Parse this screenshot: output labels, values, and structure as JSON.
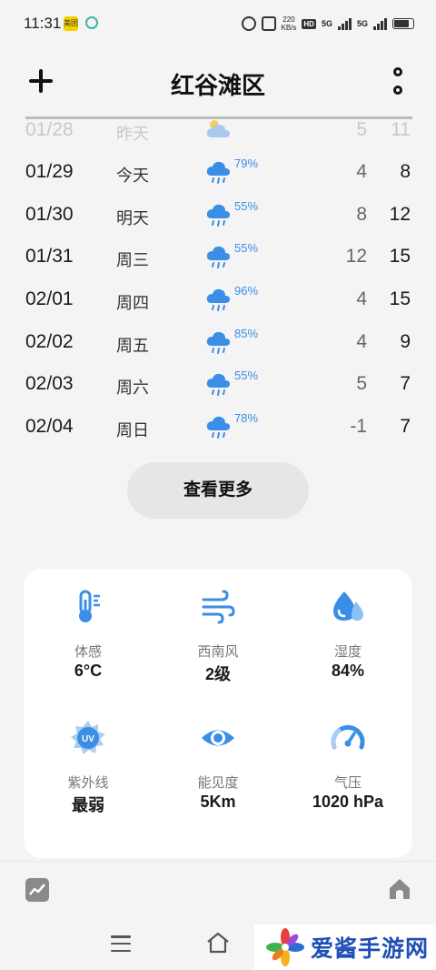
{
  "status_bar": {
    "time": "11:31",
    "app_badge_1": "美团",
    "net_speed": "220",
    "net_unit": "KB/s",
    "hd_label": "HD",
    "net_type_1": "5G",
    "net_type_2": "5G"
  },
  "header": {
    "title": "红谷滩区"
  },
  "forecast": [
    {
      "date": "01/28",
      "day": "昨天",
      "icon": "partly-cloudy-icon",
      "pop": "",
      "low": "5",
      "high": "11",
      "faded": true
    },
    {
      "date": "01/29",
      "day": "今天",
      "icon": "rain-cloud-icon",
      "pop": "79%",
      "low": "4",
      "high": "8"
    },
    {
      "date": "01/30",
      "day": "明天",
      "icon": "rain-cloud-icon",
      "pop": "55%",
      "low": "8",
      "high": "12"
    },
    {
      "date": "01/31",
      "day": "周三",
      "icon": "rain-cloud-icon",
      "pop": "55%",
      "low": "12",
      "high": "15"
    },
    {
      "date": "02/01",
      "day": "周四",
      "icon": "rain-cloud-icon",
      "pop": "96%",
      "low": "4",
      "high": "15"
    },
    {
      "date": "02/02",
      "day": "周五",
      "icon": "rain-cloud-icon",
      "pop": "85%",
      "low": "4",
      "high": "9"
    },
    {
      "date": "02/03",
      "day": "周六",
      "icon": "rain-cloud-icon",
      "pop": "55%",
      "low": "5",
      "high": "7"
    },
    {
      "date": "02/04",
      "day": "周日",
      "icon": "rain-cloud-icon",
      "pop": "78%",
      "low": "-1",
      "high": "7"
    }
  ],
  "more_button": "查看更多",
  "details": [
    {
      "label": "体感",
      "value": "6°C",
      "icon": "thermometer-icon"
    },
    {
      "label": "西南风",
      "value": "2级",
      "icon": "wind-icon"
    },
    {
      "label": "湿度",
      "value": "84%",
      "icon": "humidity-icon"
    },
    {
      "label": "紫外线",
      "value": "最弱",
      "icon": "uv-icon"
    },
    {
      "label": "能见度",
      "value": "5Km",
      "icon": "eye-icon"
    },
    {
      "label": "气压",
      "value": "1020 hPa",
      "icon": "gauge-icon"
    }
  ],
  "watermark": {
    "text": "爱酱手游网"
  },
  "colors": {
    "accent_blue": "#3a8ee6",
    "background": "#f4f4f4",
    "card": "#ffffff"
  }
}
